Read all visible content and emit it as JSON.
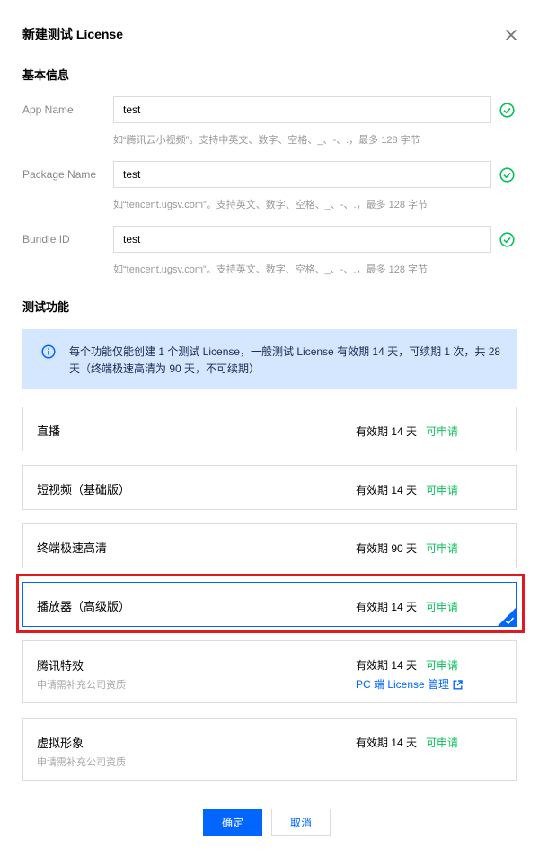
{
  "dialog": {
    "title": "新建测试 License"
  },
  "basic_info": {
    "section_title": "基本信息",
    "fields": [
      {
        "label": "App Name",
        "value": "test",
        "hint": "如“腾讯云小视频”。支持中英文、数字、空格、_、-、.，最多 128 字节"
      },
      {
        "label": "Package Name",
        "value": "test",
        "hint": "如“tencent.ugsv.com”。支持英文、数字、空格、_、-、.，最多 128 字节"
      },
      {
        "label": "Bundle ID",
        "value": "test",
        "hint": "如“tencent.ugsv.com”。支持英文、数字、空格、_、-、.，最多 128 字节"
      }
    ]
  },
  "test_features": {
    "section_title": "测试功能",
    "notice": "每个功能仅能创建 1 个测试 License，一般测试 License 有效期 14 天，可续期 1 次，共 28 天（终端极速高清为 90 天，不可续期）",
    "items": [
      {
        "name": "直播",
        "validity": "有效期 14 天",
        "status": "可申请",
        "selected": false
      },
      {
        "name": "短视频（基础版）",
        "validity": "有效期 14 天",
        "status": "可申请",
        "selected": false
      },
      {
        "name": "终端极速高清",
        "validity": "有效期 90 天",
        "status": "可申请",
        "selected": false
      },
      {
        "name": "播放器（高级版）",
        "validity": "有效期 14 天",
        "status": "可申请",
        "selected": true
      },
      {
        "name": "腾讯特效",
        "sub": "申请需补充公司资质",
        "validity": "有效期 14 天",
        "status": "可申请",
        "link": "PC 端 License 管理",
        "selected": false
      },
      {
        "name": "虚拟形象",
        "sub": "申请需补充公司资质",
        "validity": "有效期 14 天",
        "status": "可申请",
        "selected": false
      }
    ]
  },
  "buttons": {
    "confirm": "确定",
    "cancel": "取消"
  },
  "colors": {
    "primary": "#0066ff",
    "success": "#0abf5b",
    "notice_bg": "#d5e7ff",
    "highlight": "#e0181f"
  },
  "icons": [
    "close-icon",
    "check-circle-icon",
    "info-icon",
    "external-link-icon",
    "corner-check-icon"
  ]
}
